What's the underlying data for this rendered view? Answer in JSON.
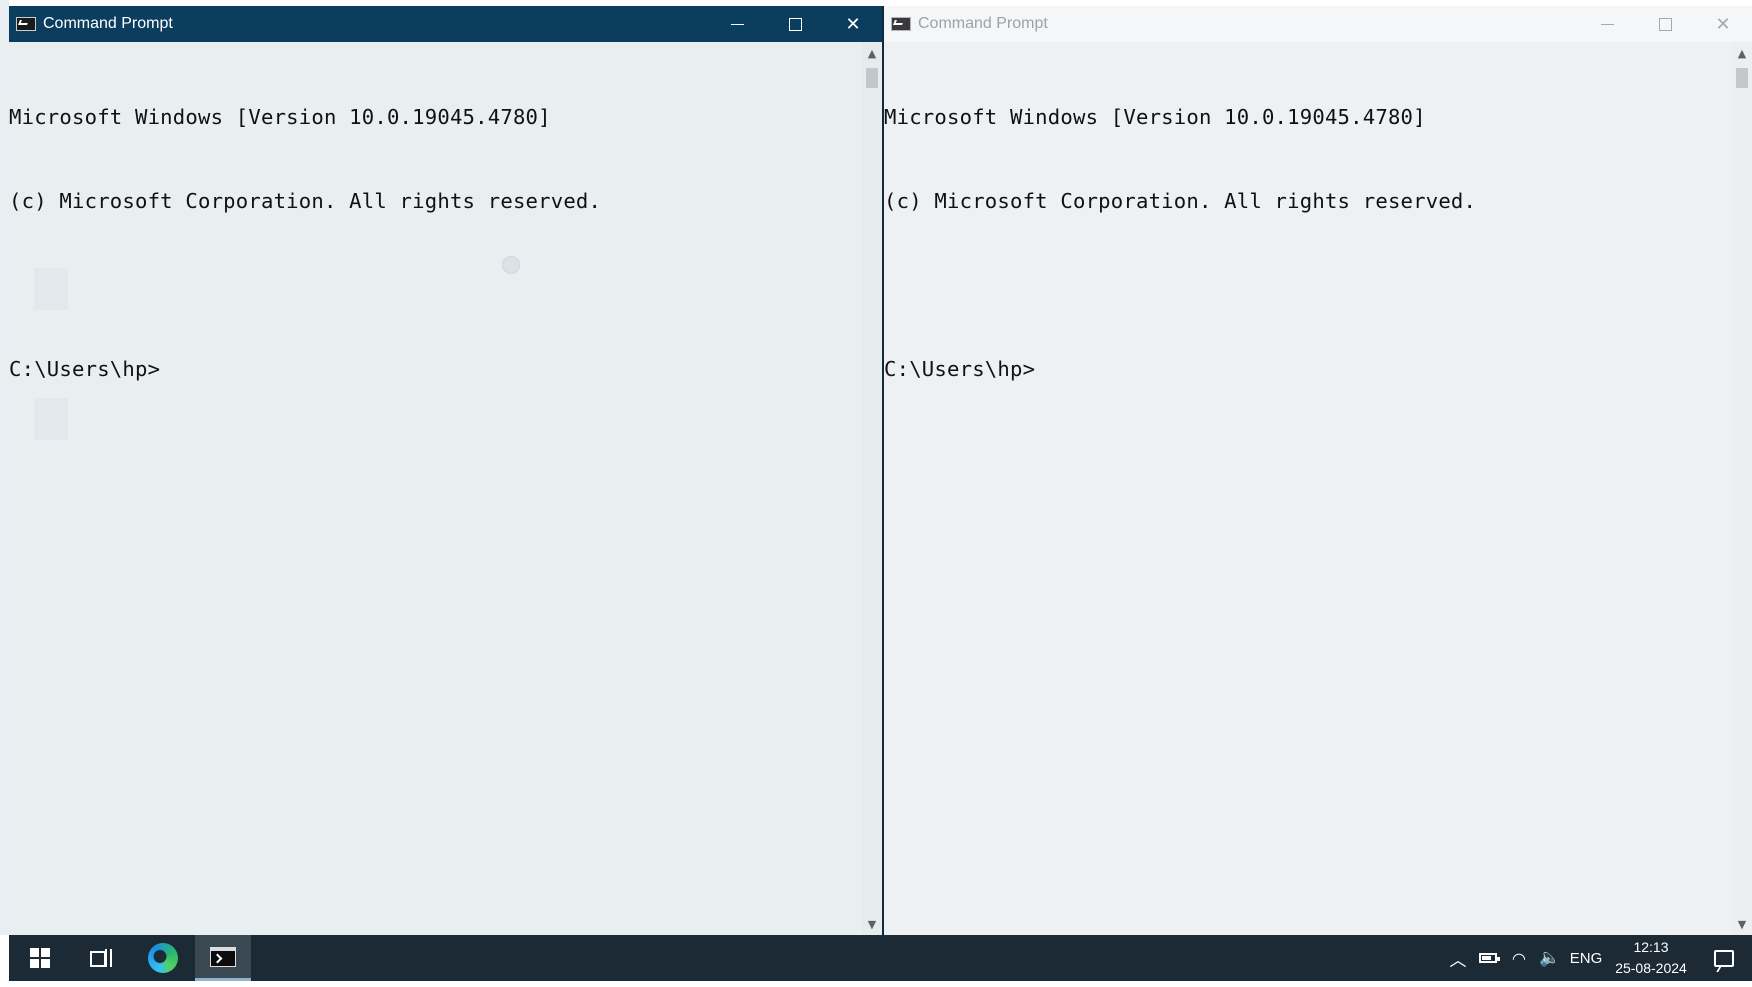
{
  "left_window": {
    "title": "Command Prompt",
    "state": "active",
    "controls": {
      "minimize": "minimize",
      "maximize": "maximize",
      "close": "close"
    },
    "console_lines": [
      "Microsoft Windows [Version 10.0.19045.4780]",
      "(c) Microsoft Corporation. All rights reserved.",
      "",
      "C:\\Users\\hp>"
    ]
  },
  "right_window": {
    "title": "Command Prompt",
    "state": "inactive",
    "console_lines": [
      "Microsoft Windows [Version 10.0.19045.4780]",
      "(c) Microsoft Corporation. All rights reserved.",
      "",
      "C:\\Users\\hp>"
    ]
  },
  "taskbar": {
    "pinned": [
      {
        "name": "start",
        "icon": "windows-logo-icon"
      },
      {
        "name": "task-view",
        "icon": "task-view-icon"
      },
      {
        "name": "edge",
        "icon": "edge-browser-icon"
      },
      {
        "name": "command-prompt",
        "icon": "command-prompt-icon",
        "active": true
      }
    ],
    "tray": {
      "language": "ENG",
      "time": "12:13",
      "date": "25-08-2024",
      "icons": [
        "chevron-up-icon",
        "battery-icon",
        "wifi-icon",
        "volume-icon",
        "notification-icon"
      ]
    }
  },
  "colors": {
    "active_titlebar": "#0b3d5f",
    "console_background": "#e9eef1",
    "taskbar": "#1c2a35",
    "console_text": "#111111"
  }
}
